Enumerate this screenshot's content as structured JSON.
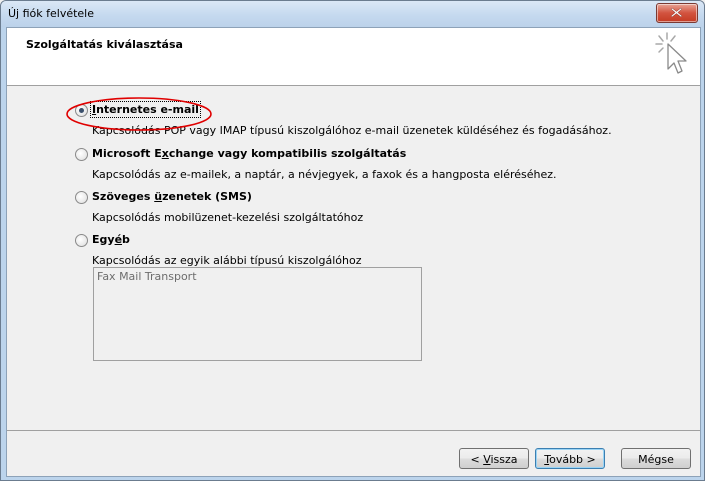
{
  "window": {
    "title": "Új fiók felvétele"
  },
  "header": {
    "title": "Szolgáltatás kiválasztása",
    "icon": "wizard-cursor-icon"
  },
  "options": [
    {
      "label_parts": [
        "",
        "I",
        "nternetes e-mail"
      ],
      "description": "Kapcsolódás POP vagy IMAP típusú kiszolgálóhoz e-mail üzenetek küldéséhez és fogadásához.",
      "selected": true
    },
    {
      "label_parts": [
        "Microsoft E",
        "x",
        "change vagy kompatibilis szolgáltatás"
      ],
      "description": "Kapcsolódás az e-mailek, a naptár, a névjegyek, a faxok és a hangposta eléréséhez.",
      "selected": false
    },
    {
      "label_parts": [
        "Szöveges ",
        "ü",
        "zenetek (SMS)"
      ],
      "description": "Kapcsolódás mobilüzenet-kezelési szolgáltatóhoz",
      "selected": false
    },
    {
      "label_parts": [
        "Egy",
        "é",
        "b"
      ],
      "description": "Kapcsolódás az egyik alábbi típusú kiszolgálóhoz",
      "selected": false
    }
  ],
  "other_list": {
    "items": [
      "Fax Mail Transport"
    ]
  },
  "buttons": {
    "back": {
      "prefix": "< ",
      "mnemonic": "V",
      "rest": "issza"
    },
    "next": {
      "mnemonic": "T",
      "rest": "ovább >"
    },
    "cancel": {
      "label": "Mégse"
    }
  },
  "colors": {
    "highlight_ellipse": "#e00000",
    "titlebar": "#c5d9ef",
    "close_button": "#c43b23"
  }
}
